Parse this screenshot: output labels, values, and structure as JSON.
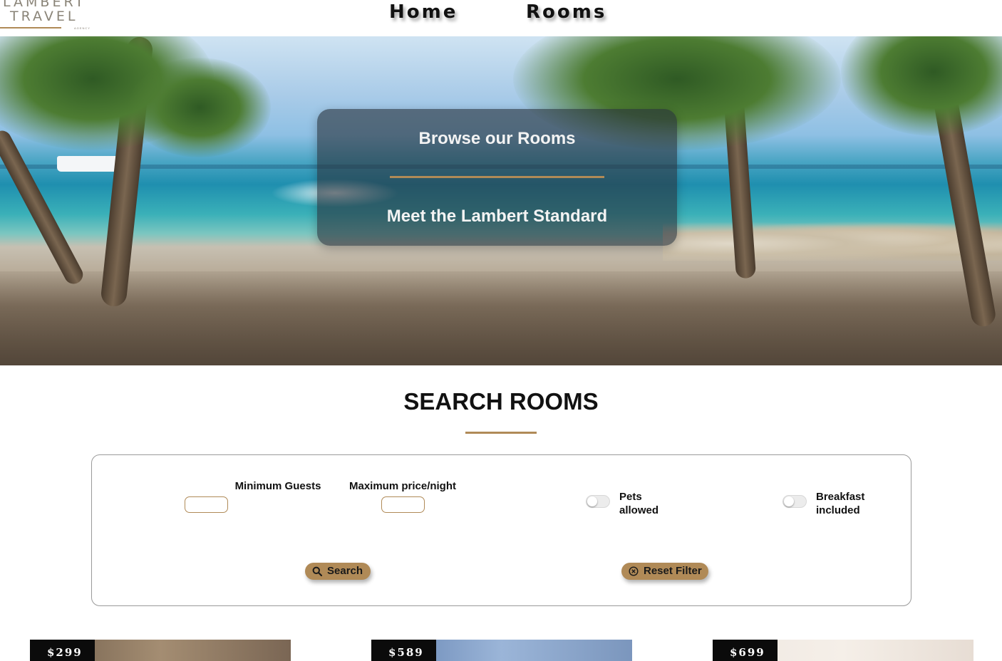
{
  "header": {
    "logo_line1": "LAMBERT",
    "logo_line2": "TRAVEL",
    "logo_sub": "AGENCY",
    "nav": [
      {
        "label": "Home"
      },
      {
        "label": "Rooms"
      }
    ]
  },
  "hero": {
    "links": [
      {
        "label": "Browse our Rooms"
      },
      {
        "label": "Meet the Lambert Standard"
      }
    ]
  },
  "search": {
    "title": "SEARCH ROOMS",
    "min_guests_label": "Minimum Guests",
    "min_guests_value": "",
    "max_price_label": "Maximum price/night",
    "max_price_value": "",
    "pets_label": "Pets allowed",
    "pets_enabled": false,
    "breakfast_label": "Breakfast included",
    "breakfast_enabled": false,
    "search_button": "Search",
    "reset_button": "Reset Filter"
  },
  "rooms": [
    {
      "price": "$299"
    },
    {
      "price": "$589"
    },
    {
      "price": "$699"
    }
  ],
  "colors": {
    "accent": "#b08a57",
    "text": "#111111",
    "overlay": "#28323c"
  }
}
